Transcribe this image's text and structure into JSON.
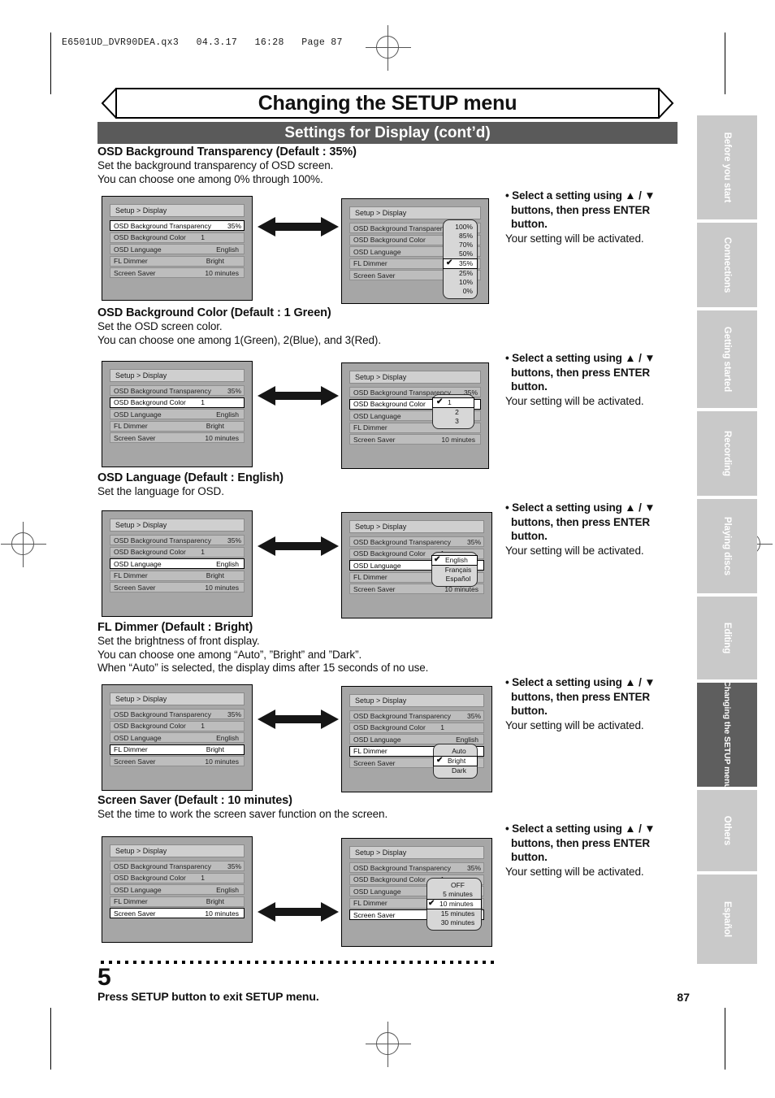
{
  "filestamp": "E6501UD_DVR90DEA.qx3   04.3.17   16:28   Page 87",
  "header": {
    "title": "Changing the SETUP menu",
    "subtitle": "Settings for Display (cont’d)"
  },
  "instruction_block": {
    "line1": "• Select a setting using ▲ / ▼",
    "line2": "buttons, then press ENTER",
    "line3": "button.",
    "line4": "Your setting will be activated."
  },
  "menu": {
    "screen_title": "Setup > Display",
    "rows": [
      {
        "label": "OSD Background Transparency",
        "value": "35%"
      },
      {
        "label": "OSD Background Color",
        "value": "1"
      },
      {
        "label": "OSD Language",
        "value": "English"
      },
      {
        "label": "FL Dimmer",
        "value": "Bright"
      },
      {
        "label": "Screen Saver",
        "value": "10 minutes"
      }
    ]
  },
  "sections": [
    {
      "id": "transparency",
      "title": "OSD Background Transparency (Default : 35%)",
      "desc1": "Set the background transparency of OSD screen.",
      "desc2": "You can choose one among 0% through 100%.",
      "highlight_index": 0,
      "options": [
        "100%",
        "85%",
        "70%",
        "50%",
        "35%",
        "25%",
        "10%",
        "0%"
      ],
      "selected": "35%"
    },
    {
      "id": "color",
      "title": "OSD Background Color (Default : 1 Green)",
      "desc1": "Set the OSD screen color.",
      "desc2": "You can choose one among 1(Green), 2(Blue), and 3(Red).",
      "highlight_index": 1,
      "options": [
        "1",
        "2",
        "3"
      ],
      "selected": "1"
    },
    {
      "id": "language",
      "title": "OSD Language (Default : English)",
      "desc1": "Set the language for OSD.",
      "desc2": "",
      "highlight_index": 2,
      "options": [
        "English",
        "Français",
        "Español"
      ],
      "selected": "English"
    },
    {
      "id": "dimmer",
      "title": "FL Dimmer (Default : Bright)",
      "desc1": "Set the brightness of front display.",
      "desc2": "You can choose one among “Auto”, ”Bright” and ”Dark”.",
      "desc3": "When “Auto” is selected, the display dims after 15 seconds of no use.",
      "highlight_index": 3,
      "options": [
        "Auto",
        "Bright",
        "Dark"
      ],
      "selected": "Bright"
    },
    {
      "id": "screensaver",
      "title": "Screen Saver (Default : 10 minutes)",
      "desc1": "Set the time to work the screen saver function on the screen.",
      "desc2": "",
      "highlight_index": 4,
      "options": [
        "OFF",
        "5 minutes",
        "10 minutes",
        "15 minutes",
        "30 minutes"
      ],
      "selected": "10 minutes"
    }
  ],
  "side_tabs": [
    {
      "label": "Before you start",
      "active": false
    },
    {
      "label": "Connections",
      "active": false
    },
    {
      "label": "Getting started",
      "active": false
    },
    {
      "label": "Recording",
      "active": false
    },
    {
      "label": "Playing discs",
      "active": false
    },
    {
      "label": "Editing",
      "active": false
    },
    {
      "label": "Changing the SETUP menu",
      "active": true
    },
    {
      "label": "Others",
      "active": false
    },
    {
      "label": "Español",
      "active": false
    }
  ],
  "footer": {
    "step_number": "5",
    "step_text": "Press SETUP button to exit SETUP menu.",
    "page_number": "87"
  },
  "colors": {
    "subtitle_bar": "#5a5a5a",
    "screen_bg": "#a6a6a6",
    "row_bg": "#bdbdbd",
    "tab_bg": "#c9c9c9",
    "tab_active_bg": "#5e5e5e"
  },
  "icons": {
    "check": "✔",
    "up_arrow": "▲",
    "down_arrow": "▼"
  }
}
